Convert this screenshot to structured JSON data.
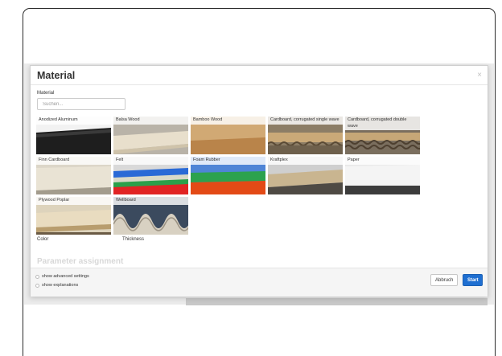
{
  "modal": {
    "title": "Material",
    "close": "×",
    "material_label": "Material",
    "search_placeholder": "Suchen..."
  },
  "materials": [
    {
      "label": "Anodized Aluminum"
    },
    {
      "label": "Balsa Wood"
    },
    {
      "label": "Bamboo Wood"
    },
    {
      "label": "Cardboard, corrugated single wave"
    },
    {
      "label": "Cardboard, corrugated double wave"
    },
    {
      "label": "Finn Cardboard"
    },
    {
      "label": "Felt"
    },
    {
      "label": "Foam Rubber"
    },
    {
      "label": "Kraftplex"
    },
    {
      "label": "Paper"
    },
    {
      "label": "Plywood Poplar"
    },
    {
      "label": "Wellboard"
    }
  ],
  "labels": {
    "color": "Color",
    "thickness": "Thickness"
  },
  "parameters": {
    "title": "Parameter assignment"
  },
  "footer": {
    "show_advanced": "show advanced settings",
    "show_explanations": "show explanations",
    "cancel": "Abbruch",
    "start": "Start"
  }
}
